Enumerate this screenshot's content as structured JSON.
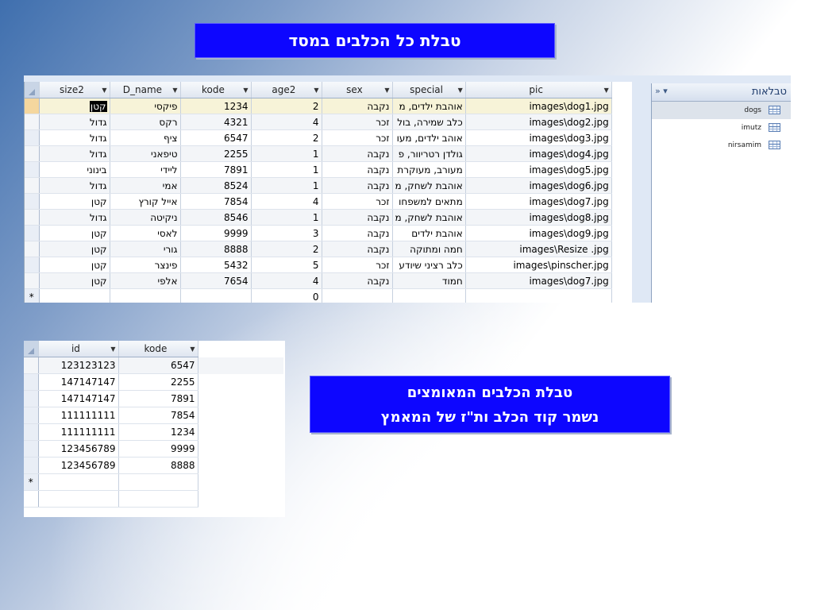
{
  "titles": {
    "dogs_table": "טבלת  כל הכלבים במסד",
    "adopted_line1": "טבלת הכלבים המאומצים",
    "adopted_line2": "נשמר קוד הכלב ות\"ז של המאמץ"
  },
  "dogs_table": {
    "columns": [
      "size2",
      "D_name",
      "kode",
      "age2",
      "sex",
      "special",
      "pic"
    ],
    "rows": [
      [
        "קטן",
        "פיקסי",
        "1234",
        "2",
        "נקבה",
        "אוהבת ילדים, מ",
        "images\\dog1.jpg"
      ],
      [
        "גדול",
        "רקס",
        "4321",
        "4",
        "זכר",
        "כלב שמירה, בול",
        "images\\dog2.jpg"
      ],
      [
        "גדול",
        "ציף",
        "6547",
        "2",
        "זכר",
        "אוהב ילדים, מעו",
        "images\\dog3.jpg"
      ],
      [
        "גדול",
        "טיפאני",
        "2255",
        "1",
        "נקבה",
        "גולדן רטריוור, פ",
        "images\\dog4.jpg"
      ],
      [
        "בינוני",
        "ליידי",
        "7891",
        "1",
        "נקבה",
        "מעורב, מעוקרת",
        "images\\dog5.jpg"
      ],
      [
        "גדול",
        "אמי",
        "8524",
        "1",
        "נקבה",
        "אוהבת לשחק, מ",
        "images\\dog6.jpg"
      ],
      [
        "קטן",
        "אייל קורץ",
        "7854",
        "4",
        "זכר",
        "מתאים למשפחו",
        "images\\dog7.jpg"
      ],
      [
        "גדול",
        "ניקיטה",
        "8546",
        "1",
        "נקבה",
        "אוהבת לשחק, מ",
        "images\\dog8.jpg"
      ],
      [
        "קטן",
        "לאסי",
        "9999",
        "3",
        "נקבה",
        "אוהבת ילדים",
        "images\\dog9.jpg"
      ],
      [
        "קטן",
        "גורי",
        "8888",
        "2",
        "נקבה",
        "חמה ומתוקה",
        "images\\Resize .jpg"
      ],
      [
        "קטן",
        "פינצר",
        "5432",
        "5",
        "זכר",
        "כלב רציני שיודע",
        "images\\pinscher.jpg"
      ],
      [
        "קטן",
        "אלפי",
        "7654",
        "4",
        "נקבה",
        "חמוד",
        "images\\dog7.jpg"
      ]
    ],
    "new_row_marker": "*",
    "new_row_default_age": "0"
  },
  "nav_pane": {
    "title": "טבלאות",
    "controls": "»  ▾",
    "items": [
      {
        "name": "dogs",
        "selected": true
      },
      {
        "name": "imutz",
        "selected": false
      },
      {
        "name": "nirsamim",
        "selected": false
      }
    ]
  },
  "imutz_table": {
    "columns": [
      "id",
      "kode"
    ],
    "rows": [
      [
        "123123123",
        "6547"
      ],
      [
        "147147147",
        "2255"
      ],
      [
        "147147147",
        "7891"
      ],
      [
        "111111111",
        "7854"
      ],
      [
        "111111111",
        "1234"
      ],
      [
        "123456789",
        "9999"
      ],
      [
        "123456789",
        "8888"
      ]
    ],
    "new_row_marker": "*"
  },
  "colors": {
    "title_bg": "#0d06ff",
    "title_text": "#ffffff",
    "header_bg": "#dfe6f0",
    "active_row": "#f5d79e"
  }
}
